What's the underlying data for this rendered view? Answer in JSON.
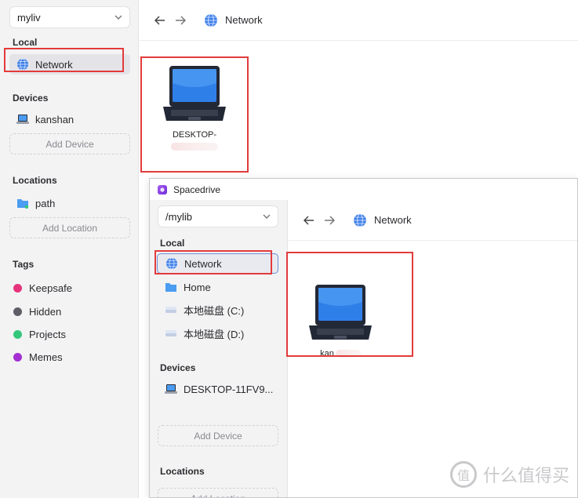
{
  "back": {
    "library": "myliv",
    "sections": {
      "local": "Local",
      "devices": "Devices",
      "locations": "Locations",
      "tags": "Tags"
    },
    "local_items": [
      {
        "label": "Network",
        "icon": "globe-icon"
      }
    ],
    "devices": [
      {
        "label": "kanshan",
        "icon": "laptop-icon"
      }
    ],
    "add_device": "Add Device",
    "locations": [
      {
        "label": "path",
        "icon": "folder-icon"
      }
    ],
    "add_location": "Add Location",
    "tags": [
      {
        "label": "Keepsafe",
        "color": "#e5337c"
      },
      {
        "label": "Hidden",
        "color": "#5e5e66"
      },
      {
        "label": "Projects",
        "color": "#34c77b"
      },
      {
        "label": "Memes",
        "color": "#a32fd1"
      }
    ],
    "breadcrumb": "Network",
    "device_card": {
      "name": "DESKTOP-",
      "icon": "laptop-icon"
    }
  },
  "front": {
    "window_title": "Spacedrive",
    "library": "/mylib",
    "sections": {
      "local": "Local",
      "devices": "Devices",
      "locations": "Locations"
    },
    "local_items": [
      {
        "label": "Network",
        "icon": "globe-icon"
      },
      {
        "label": "Home",
        "icon": "folder-icon"
      },
      {
        "label": "本地磁盘 (C:)",
        "icon": "drive-icon"
      },
      {
        "label": "本地磁盘 (D:)",
        "icon": "drive-icon"
      }
    ],
    "devices": [
      {
        "label": "DESKTOP-11FV9...",
        "icon": "laptop-icon"
      }
    ],
    "add_device": "Add Device",
    "add_location": "Add Location",
    "breadcrumb": "Network",
    "device_card": {
      "name": "kan",
      "icon": "laptop-icon"
    }
  },
  "watermark": "什么值得买",
  "colors": {
    "highlight_box": "#e23b3b",
    "globe": "#3b7de8",
    "folder": "#4a9df0"
  }
}
